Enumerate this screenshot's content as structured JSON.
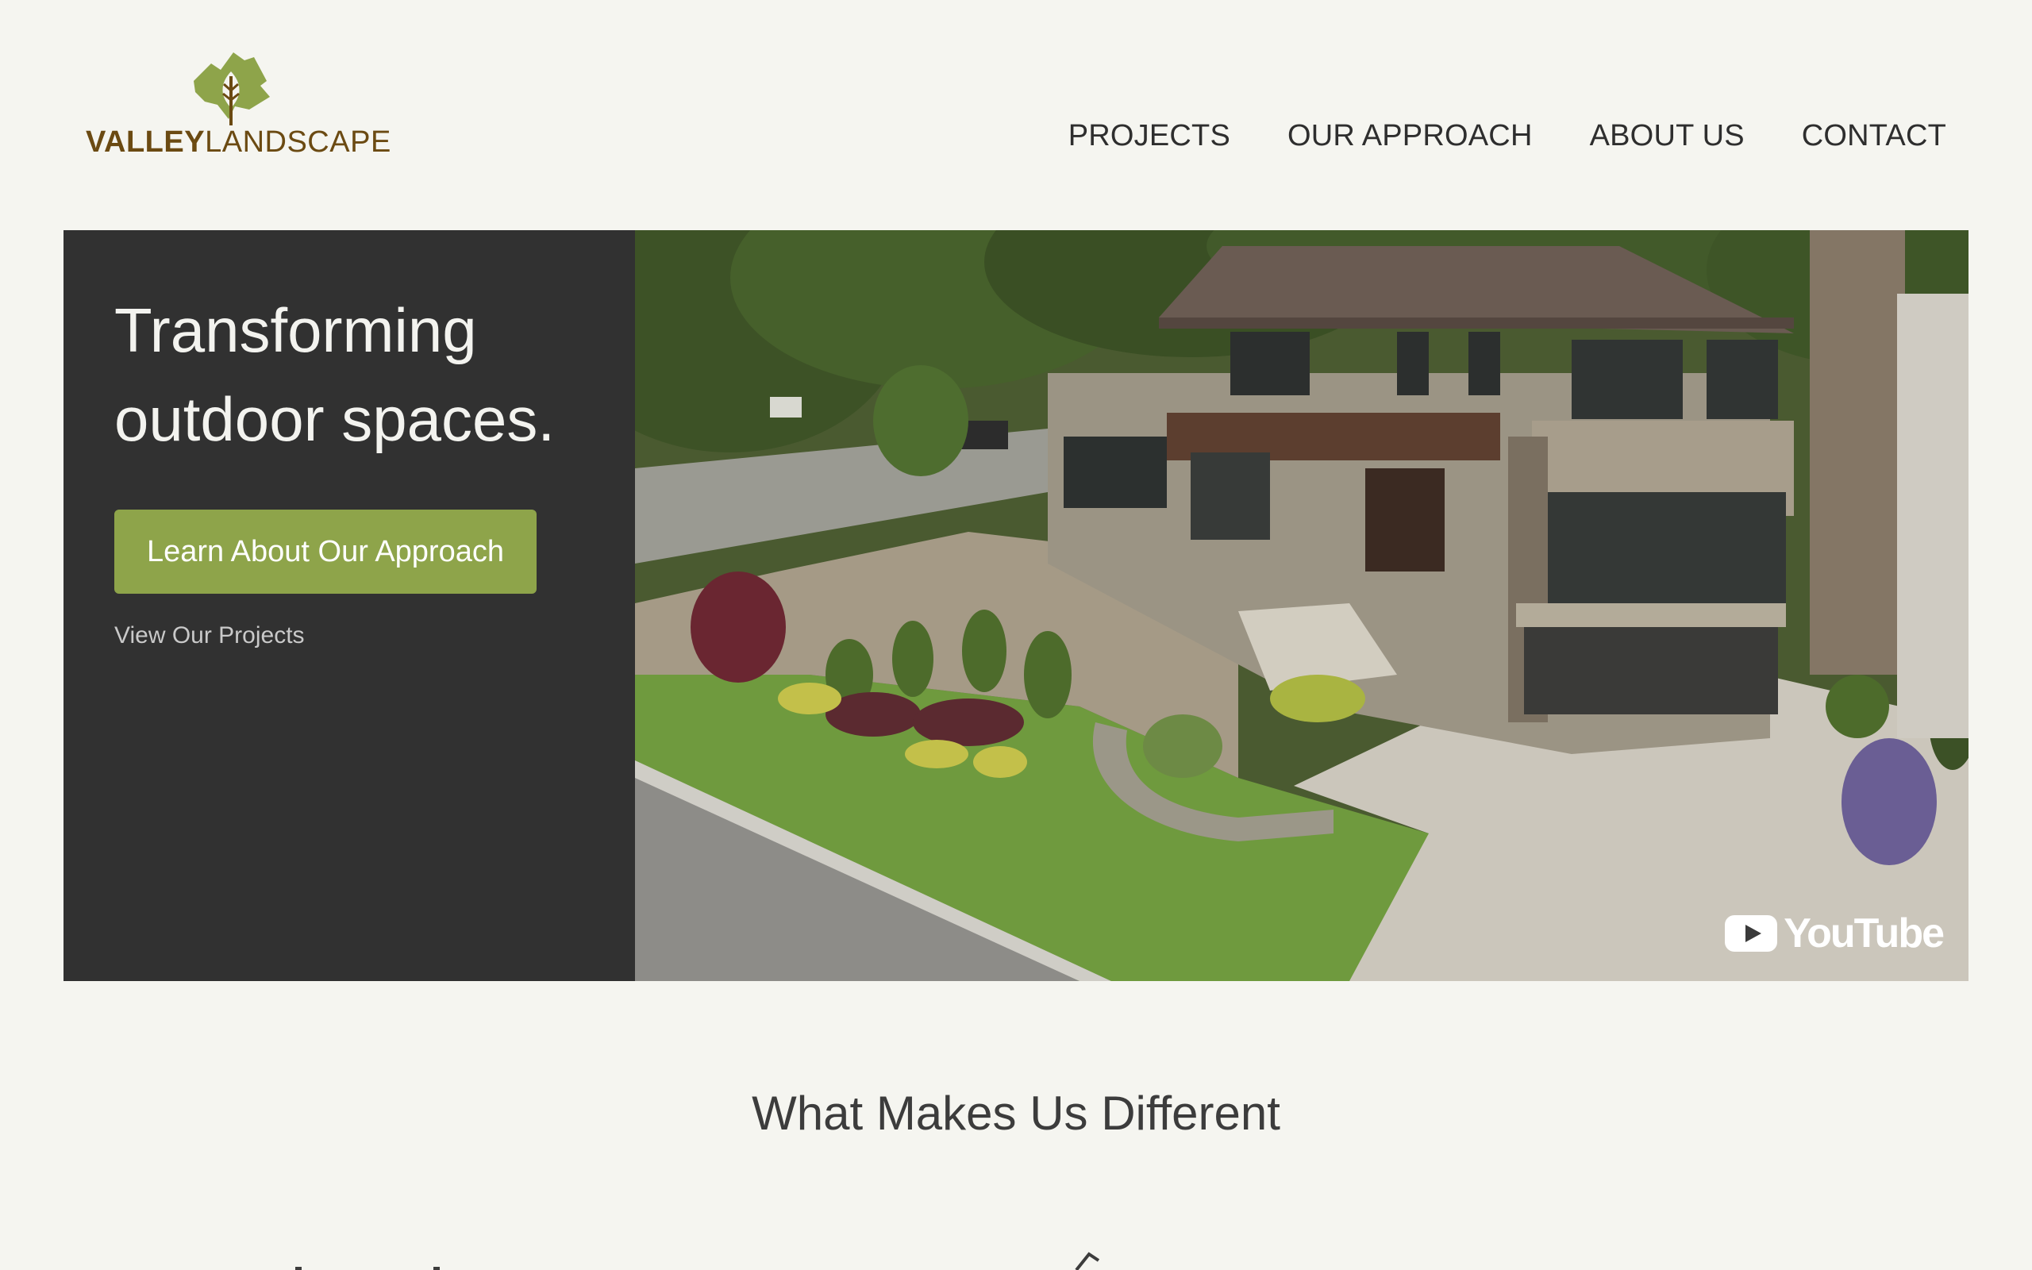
{
  "brand": {
    "name_bold": "VALLEY",
    "name_light": "LANDSCAPE",
    "color_brown": "#6b4a12",
    "color_green": "#8ea44a",
    "icon": "leaf-logo-icon"
  },
  "nav": {
    "items": [
      {
        "label": "PROJECTS"
      },
      {
        "label": "OUR APPROACH"
      },
      {
        "label": "ABOUT US"
      },
      {
        "label": "CONTACT"
      }
    ]
  },
  "hero": {
    "title_line1": "Transforming",
    "title_line2": "outdoor spaces.",
    "primary_button": "Learn About Our Approach",
    "secondary_link": "View Our Projects",
    "panel_color": "#313131",
    "video": {
      "badge_text": "YouTube",
      "icon": "youtube-play-icon"
    }
  },
  "section": {
    "title": "What Makes Us Different"
  },
  "colors": {
    "background": "#f5f5f0",
    "button_green": "#8ea44a"
  }
}
